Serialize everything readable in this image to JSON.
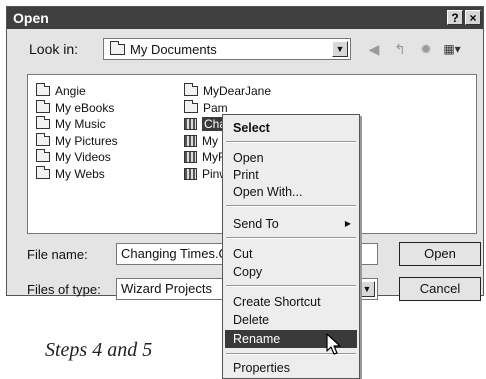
{
  "window": {
    "title": "Open",
    "help_label": "?",
    "close_label": "×"
  },
  "lookin": {
    "label": "Look in:",
    "value": "My Documents"
  },
  "toolbar": {
    "icons": [
      "back-icon",
      "up-folder-icon",
      "new-folder-icon",
      "views-icon"
    ],
    "back_glyph": "◀",
    "up_glyph": "↰",
    "newfolder_glyph": "✹",
    "views_glyph": "▦▾"
  },
  "files": {
    "col1": [
      {
        "label": "Angie",
        "icon": "folder-icon"
      },
      {
        "label": "My eBooks",
        "icon": "folder-icon"
      },
      {
        "label": "My Music",
        "icon": "music-folder-icon"
      },
      {
        "label": "My Pictures",
        "icon": "pictures-folder-icon"
      },
      {
        "label": "My Videos",
        "icon": "videos-folder-icon"
      },
      {
        "label": "My Webs",
        "icon": "folder-icon"
      }
    ],
    "col2": [
      {
        "label": "MyDearJane",
        "icon": "folder-icon"
      },
      {
        "label": "Pam",
        "icon": "folder-icon"
      },
      {
        "label": "Changing Times.QDV",
        "icon": "project-file-icon",
        "selected": true
      },
      {
        "label": "My E",
        "icon": "document-file-icon"
      },
      {
        "label": "MyFi",
        "icon": "project-file-icon"
      },
      {
        "label": "Pinw",
        "icon": "project-file-icon"
      }
    ]
  },
  "filename": {
    "label": "File name:",
    "value": "Changing Times.QDV"
  },
  "filetype": {
    "label": "Files of type:",
    "value": "Wizard Projects"
  },
  "buttons": {
    "open": "Open",
    "cancel": "Cancel"
  },
  "context_menu": {
    "items": [
      {
        "label": "Select",
        "bold": true
      },
      {
        "label": "Open"
      },
      {
        "label": "Print"
      },
      {
        "label": "Open With..."
      },
      {
        "label": "Send To",
        "submenu": true
      },
      {
        "label": "Cut"
      },
      {
        "label": "Copy"
      },
      {
        "label": "Create Shortcut"
      },
      {
        "label": "Delete"
      },
      {
        "label": "Rename",
        "highlighted": true
      },
      {
        "label": "Properties"
      }
    ],
    "submenu_arrow": "▶"
  },
  "caption": "Steps 4 and 5",
  "colors": {
    "titlebar": "#3f3f3f",
    "dialog_bg": "#e4e4e4",
    "highlight": "#3a3a3a"
  }
}
